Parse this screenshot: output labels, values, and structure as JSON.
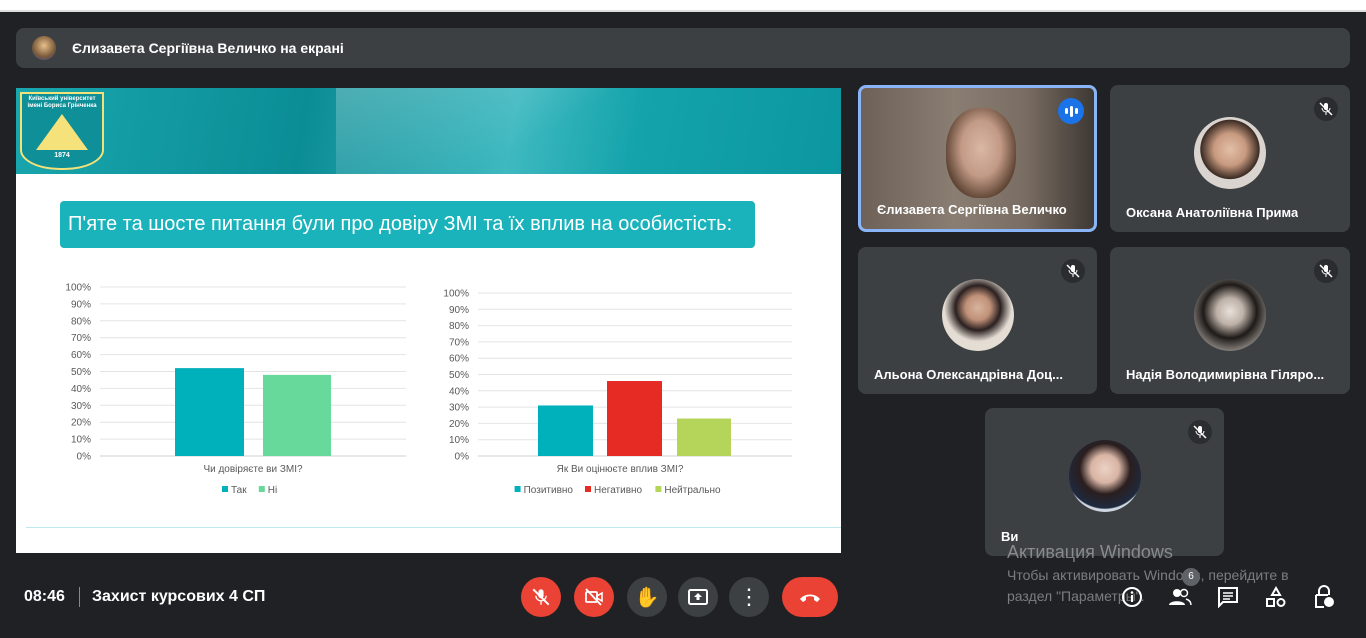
{
  "banner": {
    "presenter_text": "Єлизавета Сергіївна Величко на екрані"
  },
  "slide": {
    "logo_text": "Київський університет імені Бориса Грінченка",
    "logo_year": "1874",
    "title": "П'яте та шосте питання були про довіру ЗМІ та їх вплив на особистість:"
  },
  "chart_data": [
    {
      "type": "bar",
      "title": "",
      "xlabel": "Чи довіряєте ви ЗМІ?",
      "ylabel": "",
      "ylim": [
        0,
        100
      ],
      "yticks": [
        "0%",
        "10%",
        "20%",
        "30%",
        "40%",
        "50%",
        "60%",
        "70%",
        "80%",
        "90%",
        "100%"
      ],
      "series": [
        {
          "name": "Так",
          "values": [
            52
          ],
          "color": "#00b0bb"
        },
        {
          "name": "Ні",
          "values": [
            48
          ],
          "color": "#66d99b"
        }
      ],
      "legend": "bottom"
    },
    {
      "type": "bar",
      "title": "",
      "xlabel": "Як Ви оцінюєте вплив ЗМІ?",
      "ylabel": "",
      "ylim": [
        0,
        100
      ],
      "yticks": [
        "0%",
        "10%",
        "20%",
        "30%",
        "40%",
        "50%",
        "60%",
        "70%",
        "80%",
        "90%",
        "100%"
      ],
      "series": [
        {
          "name": "Позитивно",
          "values": [
            31
          ],
          "color": "#00b0bb"
        },
        {
          "name": "Негативно",
          "values": [
            46
          ],
          "color": "#e52b24"
        },
        {
          "name": "Нейтрально",
          "values": [
            23
          ],
          "color": "#b5d55a"
        }
      ],
      "legend": "bottom"
    }
  ],
  "participants": [
    {
      "name": "Єлизавета Сергіївна Величко",
      "speaking": true
    },
    {
      "name": "Оксана Анатоліївна Прима",
      "muted": true
    },
    {
      "name": "Альона Олександрівна Доц...",
      "muted": true
    },
    {
      "name": "Надія Володимирівна Гіляро...",
      "muted": true
    },
    {
      "name": "Ви",
      "muted": true
    }
  ],
  "meeting": {
    "time": "08:46",
    "title": "Захист курсових 4 СП",
    "participants_count": "6"
  },
  "watermark": {
    "title": "Активация Windows",
    "line1": "Чтобы активировать Windows, перейдите в",
    "line2": "раздел \"Параметры\"."
  },
  "colors": {
    "accent": "#8ab4f8",
    "end_call": "#ea4335",
    "slide_teal": "#1ab3bc"
  }
}
